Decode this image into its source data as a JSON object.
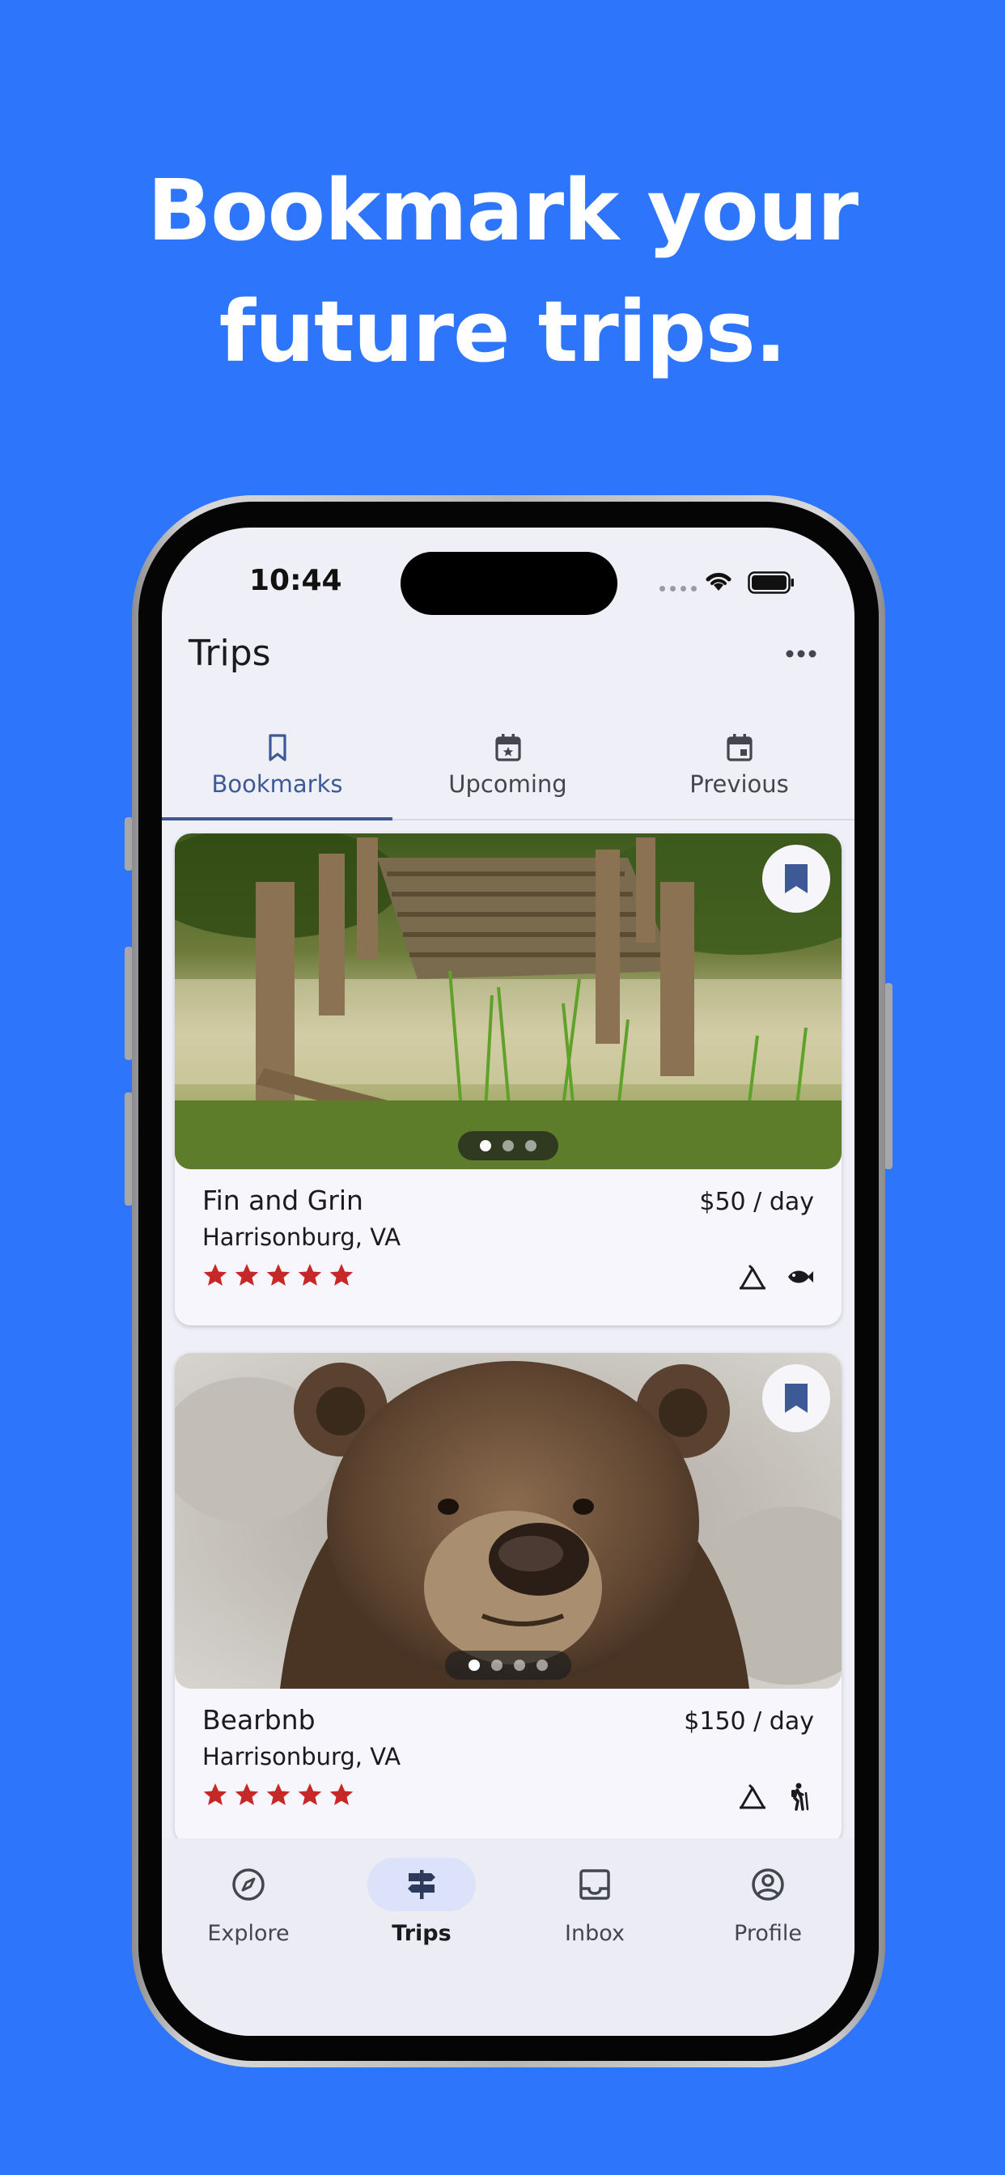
{
  "headline": {
    "line1": "Bookmark your",
    "line2": "future trips."
  },
  "status_bar": {
    "time": "10:44"
  },
  "app_bar": {
    "title": "Trips",
    "more_icon": "more-horiz-icon"
  },
  "tabs": [
    {
      "label": "Bookmarks",
      "icon": "bookmark-icon",
      "active": true
    },
    {
      "label": "Upcoming",
      "icon": "calendar-star-icon",
      "active": false
    },
    {
      "label": "Previous",
      "icon": "calendar-icon",
      "active": false
    }
  ],
  "listings": [
    {
      "name": "Fin and Grin",
      "price": "$50 / day",
      "location": "Harrisonburg, VA",
      "rating": 5,
      "photo": "wooden-dock-pond-photo",
      "photo_count": 3,
      "current_photo": 1,
      "amenities": [
        "tent-icon",
        "fish-icon"
      ],
      "bookmarked": true
    },
    {
      "name": "Bearbnb",
      "price": "$150 / day",
      "location": "Harrisonburg, VA",
      "rating": 5,
      "photo": "brown-bear-photo",
      "photo_count": 4,
      "current_photo": 1,
      "amenities": [
        "tent-icon",
        "hiking-icon"
      ],
      "bookmarked": true
    }
  ],
  "bottom_nav": [
    {
      "label": "Explore",
      "icon": "compass-icon",
      "active": false
    },
    {
      "label": "Trips",
      "icon": "signpost-icon",
      "active": true
    },
    {
      "label": "Inbox",
      "icon": "inbox-icon",
      "active": false
    },
    {
      "label": "Profile",
      "icon": "account-circle-icon",
      "active": false
    }
  ],
  "colors": {
    "background": "#2d75fa",
    "accent": "#3d5a96",
    "star": "#c62828",
    "surface": "#efeff7"
  }
}
